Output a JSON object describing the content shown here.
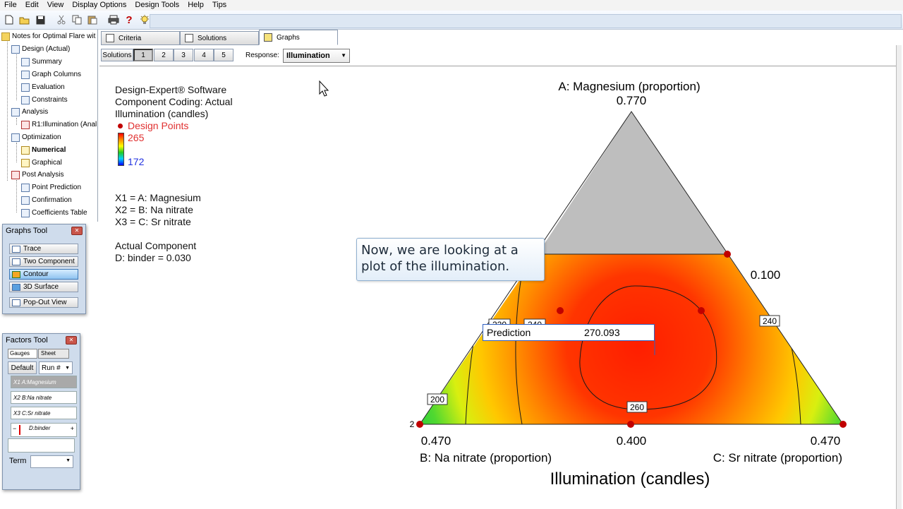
{
  "menubar": {
    "items": [
      "File",
      "Edit",
      "View",
      "Display Options",
      "Design Tools",
      "Help",
      "Tips"
    ]
  },
  "toolbar": {
    "icons": [
      "new-file-icon",
      "open-folder-icon",
      "save-icon",
      "cut-icon",
      "copy-icon",
      "paste-icon",
      "print-icon",
      "help-icon",
      "tip-lightbulb-icon"
    ],
    "help_glyph": "?"
  },
  "tree": {
    "root": "Notes for Optimal Flare wit",
    "design": "Design (Actual)",
    "summary": "Summary",
    "graph_columns": "Graph Columns",
    "evaluation": "Evaluation",
    "constraints": "Constraints",
    "analysis": "Analysis",
    "r1": "R1:Illumination (Anal",
    "optimization": "Optimization",
    "numerical": "Numerical",
    "graphical": "Graphical",
    "post_analysis": "Post Analysis",
    "point_prediction": "Point Prediction",
    "confirmation": "Confirmation",
    "coefficients_table": "Coefficients Table"
  },
  "graphs_tool": {
    "title": "Graphs Tool",
    "buttons": [
      "Trace",
      "Two Component",
      "Contour",
      "3D Surface",
      "Pop-Out View"
    ],
    "active": "Contour"
  },
  "factors_tool": {
    "title": "Factors Tool",
    "tab_gauges": "Gauges",
    "tab_sheet": "Sheet",
    "default_btn": "Default",
    "run_select": "Run #",
    "x1": "X1 A:Magnesium",
    "x2": "X2 B:Na nitrate",
    "x3": "X3 C:Sr nitrate",
    "d_label": "D:binder",
    "minus": "−",
    "plus": "+",
    "term_label": "Term"
  },
  "tabs": {
    "criteria": "Criteria",
    "solutions": "Solutions",
    "graphs": "Graphs",
    "active": "Graphs"
  },
  "solution_bar": {
    "label": "Solutions",
    "numbers": [
      "1",
      "2",
      "3",
      "4",
      "5"
    ],
    "selected": "1",
    "response_label": "Response:",
    "response_value": "Illumination"
  },
  "plot_info": {
    "software": "Design-Expert® Software",
    "coding": "Component Coding: Actual",
    "response": "Illumination (candles)",
    "design_points": "Design Points",
    "high": "265",
    "low": "172",
    "x1": "X1 = A: Magnesium",
    "x2": "X2 = B: Na nitrate",
    "x3": "X3 = C: Sr nitrate",
    "actual_component": "Actual Component",
    "binder": "D: binder = 0.030"
  },
  "colors": {
    "design_point": "#c00000",
    "legend_high_text": "#e03030",
    "legend_low_text": "#2030e0",
    "constraint_gray": "#bebebe",
    "callout_border": "#8fb0d0"
  },
  "ternary": {
    "apex_title": "A: Magnesium (proportion)",
    "apex_value": "0.770",
    "left_value": "0.470",
    "left_title": "B: Na nitrate (proportion)",
    "right_value": "0.470",
    "right_title": "C: Sr nitrate (proportion)",
    "bottom_value": "0.400",
    "right_edge_value": "0.100",
    "axis_title": "Illumination (candles)",
    "replicate_label": "2",
    "contours": [
      "220",
      "240",
      "240",
      "200",
      "260"
    ]
  },
  "prediction": {
    "label": "Prediction",
    "value": "270.093"
  },
  "callout": {
    "line1": "Now, we are looking at a",
    "line2": "plot of the illumination."
  }
}
